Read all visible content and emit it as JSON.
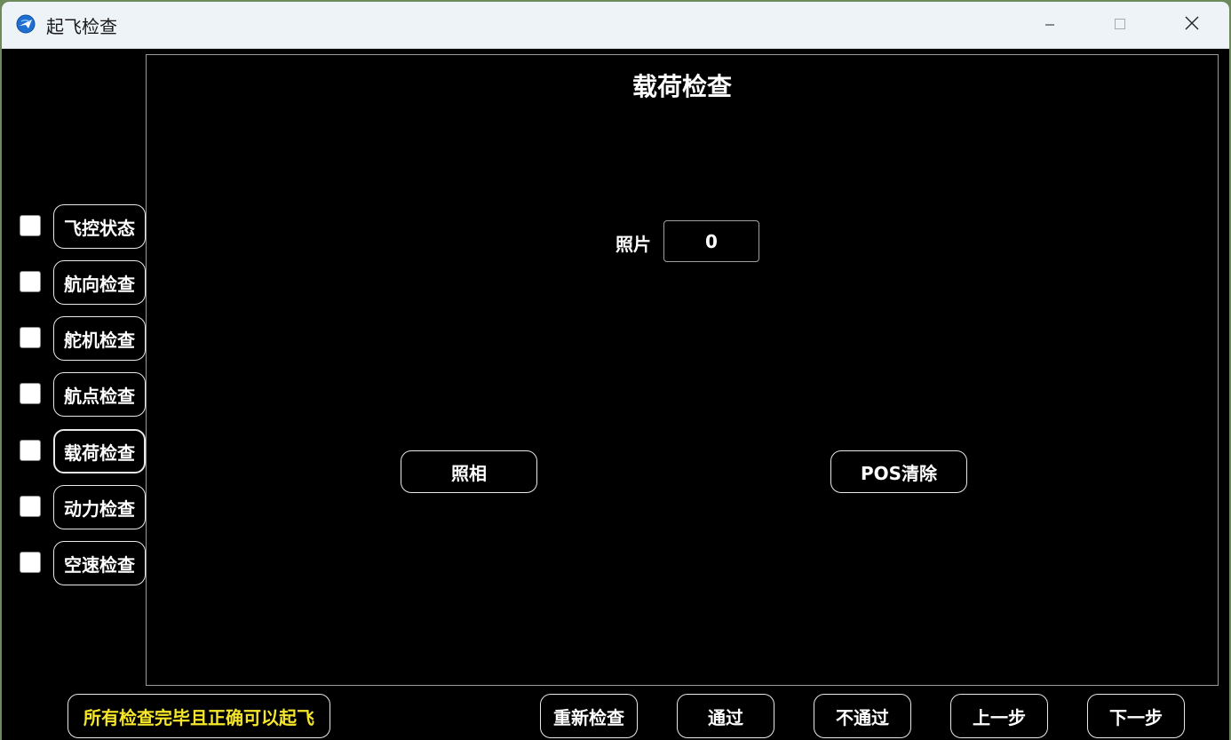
{
  "window": {
    "title": "起飞检查",
    "app_icon": "globe-plane-icon"
  },
  "titlebar_controls": {
    "minimize_icon": "minimize-icon",
    "maximize_icon": "maximize-icon",
    "close_icon": "close-icon"
  },
  "sidebar": {
    "steps": [
      {
        "label": "飞控状态",
        "checked": false
      },
      {
        "label": "航向检查",
        "checked": false
      },
      {
        "label": "舵机检查",
        "checked": false
      },
      {
        "label": "航点检查",
        "checked": false
      },
      {
        "label": "载荷检查",
        "checked": false,
        "active": true
      },
      {
        "label": "动力检查",
        "checked": false
      },
      {
        "label": "空速检查",
        "checked": false
      }
    ]
  },
  "main": {
    "title": "载荷检查",
    "photo_label": "照片",
    "photo_count": "0",
    "take_photo_label": "照相",
    "pos_clear_label": "POS清除"
  },
  "footer": {
    "notice": "所有检查完毕且正确可以起飞",
    "recheck_label": "重新检查",
    "pass_label": "通过",
    "fail_label": "不通过",
    "prev_label": "上一步",
    "next_label": "下一步"
  },
  "colors": {
    "background": "#000000",
    "text": "#ffffff",
    "notice_text": "#f5e62a",
    "titlebar": "#eef3f8"
  }
}
